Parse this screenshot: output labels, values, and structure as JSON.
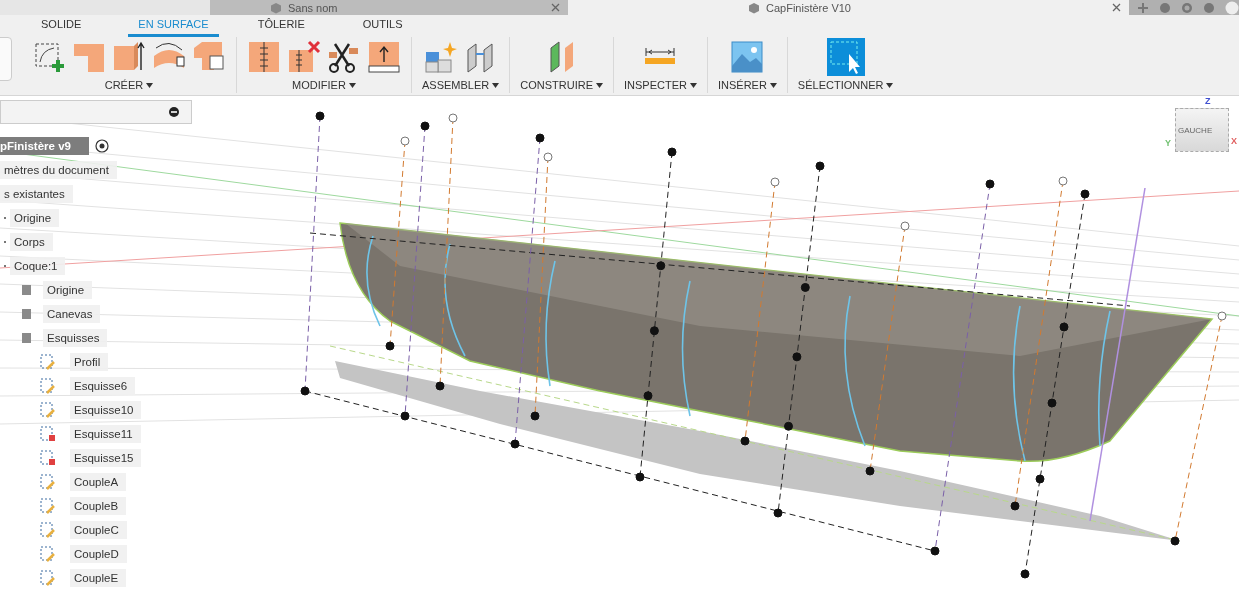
{
  "document_tabs": [
    {
      "title": "Sans nom",
      "selected": false
    },
    {
      "title": "CapFinistère V10",
      "selected": true
    }
  ],
  "ribbon": {
    "tabs": [
      {
        "label": "SOLIDE",
        "selected": false
      },
      {
        "label": "EN SURFACE",
        "selected": true
      },
      {
        "label": "TÔLERIE",
        "selected": false
      },
      {
        "label": "OUTILS",
        "selected": false
      }
    ],
    "groups": [
      {
        "label": "CRÉER",
        "tools": [
          {
            "kind": "sketch"
          },
          {
            "kind": "extrude"
          },
          {
            "kind": "extrude-up"
          },
          {
            "kind": "revolve"
          },
          {
            "kind": "patch"
          }
        ]
      },
      {
        "label": "MODIFIER",
        "tools": [
          {
            "kind": "press-pull"
          },
          {
            "kind": "delete"
          },
          {
            "kind": "trim"
          },
          {
            "kind": "offset"
          }
        ]
      },
      {
        "label": "ASSEMBLER",
        "tools": [
          {
            "kind": "new-component"
          },
          {
            "kind": "joint"
          }
        ]
      },
      {
        "label": "CONSTRUIRE",
        "tools": [
          {
            "kind": "plane"
          }
        ]
      },
      {
        "label": "INSPECTER",
        "tools": [
          {
            "kind": "measure"
          }
        ]
      },
      {
        "label": "INSÉRER",
        "tools": [
          {
            "kind": "image"
          }
        ]
      },
      {
        "label": "SÉLECTIONNER",
        "tools": [
          {
            "kind": "select"
          }
        ]
      }
    ]
  },
  "browser": {
    "tree": [
      {
        "label": "pFinistère v9",
        "kind": "root",
        "children": [
          {
            "label": "mètres du document",
            "kind": "plain"
          },
          {
            "label": "s existantes",
            "kind": "plain"
          },
          {
            "label": "Origine",
            "kind": "node"
          },
          {
            "label": "Corps",
            "kind": "node"
          },
          {
            "label": "Coque:1",
            "kind": "node",
            "children": [
              {
                "label": "Origine",
                "kind": "folder"
              },
              {
                "label": "Canevas",
                "kind": "folder"
              },
              {
                "label": "Esquisses",
                "kind": "folder",
                "children": [
                  {
                    "label": "Profil",
                    "kind": "sketch"
                  },
                  {
                    "label": "Esquisse6",
                    "kind": "sketch"
                  },
                  {
                    "label": "Esquisse10",
                    "kind": "sketch"
                  },
                  {
                    "label": "Esquisse11",
                    "kind": "locked-sketch"
                  },
                  {
                    "label": "Esquisse15",
                    "kind": "locked-sketch"
                  },
                  {
                    "label": "CoupleA",
                    "kind": "sketch"
                  },
                  {
                    "label": "CoupleB",
                    "kind": "sketch"
                  },
                  {
                    "label": "CoupleC",
                    "kind": "sketch"
                  },
                  {
                    "label": "CoupleD",
                    "kind": "sketch"
                  },
                  {
                    "label": "CoupleE",
                    "kind": "sketch"
                  }
                ]
              }
            ]
          }
        ]
      }
    ]
  },
  "viewcube": {
    "face": "GAUCHE",
    "axes": [
      {
        "label": "Z",
        "kind": "z"
      },
      {
        "label": "Y",
        "kind": "y"
      },
      {
        "label": "X",
        "kind": "x"
      }
    ]
  }
}
